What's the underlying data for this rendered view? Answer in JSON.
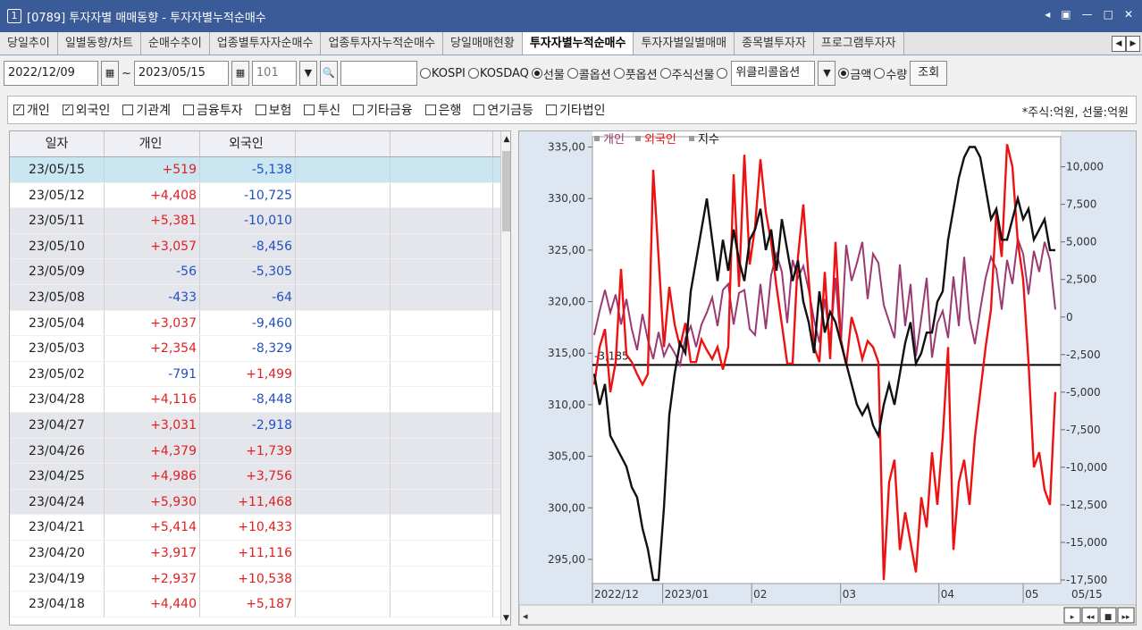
{
  "window": {
    "number": "1",
    "title": "[0789] 투자자별 매매동향 - 투자자별누적순매수",
    "controls": [
      "◂",
      "▣",
      "—",
      "□",
      "✕"
    ]
  },
  "tabs": [
    "당일추이",
    "일별동향/차트",
    "순매수추이",
    "업종별투자자순매수",
    "업종투자자누적순매수",
    "당일매매현황",
    "투자자별누적순매수",
    "투자자별일별매매",
    "종목별투자자",
    "프로그램투자자"
  ],
  "active_tab": 6,
  "toolbar": {
    "start_date": "2022/12/09",
    "tilde": "~",
    "end_date": "2023/05/15",
    "code": "101",
    "code_input": "",
    "market_radios": [
      {
        "label": "KOSPI",
        "checked": false
      },
      {
        "label": "KOSDAQ",
        "checked": false
      },
      {
        "label": "선물",
        "checked": true
      },
      {
        "label": "콜옵션",
        "checked": false
      },
      {
        "label": "풋옵션",
        "checked": false
      },
      {
        "label": "주식선물",
        "checked": false
      },
      {
        "label": "",
        "checked": false
      }
    ],
    "weekly_select": "위클리콜옵션",
    "unit_radios": [
      {
        "label": "금액",
        "checked": true
      },
      {
        "label": "수량",
        "checked": false
      }
    ],
    "search_button": "조회"
  },
  "investor_checks": [
    {
      "label": "개인",
      "checked": true
    },
    {
      "label": "외국인",
      "checked": true
    },
    {
      "label": "기관계",
      "checked": false
    },
    {
      "label": "금융투자",
      "checked": false
    },
    {
      "label": "보험",
      "checked": false
    },
    {
      "label": "투신",
      "checked": false
    },
    {
      "label": "기타금융",
      "checked": false
    },
    {
      "label": "은행",
      "checked": false
    },
    {
      "label": "연기금등",
      "checked": false
    },
    {
      "label": "기타법인",
      "checked": false
    }
  ],
  "unit_note": "*주식:억원, 선물:억원",
  "table": {
    "headers": [
      "일자",
      "개인",
      "외국인",
      "",
      ""
    ],
    "rows": [
      [
        "23/05/15",
        "+519",
        "-5,138"
      ],
      [
        "23/05/12",
        "+4,408",
        "-10,725"
      ],
      [
        "23/05/11",
        "+5,381",
        "-10,010"
      ],
      [
        "23/05/10",
        "+3,057",
        "-8,456"
      ],
      [
        "23/05/09",
        "-56",
        "-5,305"
      ],
      [
        "23/05/08",
        "-433",
        "-64"
      ],
      [
        "23/05/04",
        "+3,037",
        "-9,460"
      ],
      [
        "23/05/03",
        "+2,354",
        "-8,329"
      ],
      [
        "23/05/02",
        "-791",
        "+1,499"
      ],
      [
        "23/04/28",
        "+4,116",
        "-8,448"
      ],
      [
        "23/04/27",
        "+3,031",
        "-2,918"
      ],
      [
        "23/04/26",
        "+4,379",
        "+1,739"
      ],
      [
        "23/04/25",
        "+4,986",
        "+3,756"
      ],
      [
        "23/04/24",
        "+5,930",
        "+11,468"
      ],
      [
        "23/04/21",
        "+5,414",
        "+10,433"
      ],
      [
        "23/04/20",
        "+3,917",
        "+11,116"
      ],
      [
        "23/04/19",
        "+2,937",
        "+10,538"
      ],
      [
        "23/04/18",
        "+4,440",
        "+5,187"
      ]
    ]
  },
  "chart_data": {
    "type": "line",
    "legend": [
      "개인",
      "외국인",
      "지수"
    ],
    "legend_placement": "top-left",
    "left_axis": {
      "ticks": [
        "335,00",
        "330,00",
        "325,00",
        "320,00",
        "315,00",
        "310,00",
        "305,00",
        "300,00",
        "295,00"
      ],
      "ylim": [
        293,
        336
      ]
    },
    "right_axis": {
      "ticks": [
        "10,000",
        "7,500",
        "5,000",
        "2,500",
        "0",
        "-2,500",
        "-5,000",
        "-7,500",
        "-10,000",
        "-12,500",
        "-15,000",
        "-17,500"
      ],
      "ylim": [
        -17500,
        12000
      ]
    },
    "x_labels": [
      "2022/12",
      "2023/01",
      "02",
      "03",
      "04",
      "05",
      "05/15"
    ],
    "reference_label": "-3,185",
    "reference_value": -3185,
    "series": [
      {
        "name": "개인",
        "color": "#9b3a72",
        "axis": "right",
        "values": [
          -1200,
          400,
          1800,
          300,
          1500,
          -500,
          1200,
          -800,
          -2200,
          200,
          -1500,
          -2800,
          -1000,
          -2600,
          -1800,
          -2400,
          -3200,
          -1400,
          -600,
          -2000,
          -500,
          300,
          1300,
          -600,
          1800,
          2200,
          -500,
          1600,
          1800,
          -800,
          -1200,
          2200,
          -800,
          2800,
          4200,
          3000,
          -400,
          3800,
          2600,
          3400,
          1800,
          -200,
          -1700,
          1200,
          -1600,
          2600,
          -1800,
          4800,
          2400,
          3600,
          5000,
          1200,
          4200,
          3600,
          800,
          -300,
          -1400,
          3500,
          -600,
          2200,
          -2600,
          -100,
          2600,
          -2700,
          -400,
          400,
          -1400,
          2700,
          -600,
          4000,
          -100,
          -1800,
          500,
          2600,
          4000,
          3200,
          500,
          3800,
          2200,
          5200,
          4200,
          1500,
          4400,
          3000,
          5000,
          3800,
          500
        ]
      },
      {
        "name": "외국인",
        "color": "#ee1111",
        "axis": "right",
        "values": [
          -4500,
          -2000,
          -800,
          -5000,
          -3000,
          3200,
          -2500,
          -3000,
          -3800,
          -4500,
          -3800,
          9800,
          4000,
          -2000,
          2000,
          -500,
          -2000,
          -400,
          -3000,
          -3000,
          -1500,
          -2200,
          -2800,
          -2000,
          -3500,
          -2000,
          9500,
          2000,
          10800,
          3500,
          6000,
          10500,
          7000,
          5000,
          2000,
          -500,
          -3100,
          -3100,
          4000,
          7500,
          2500,
          -2000,
          -3000,
          3000,
          -2800,
          5000,
          -1500,
          -3200,
          0,
          -1200,
          -2800,
          -1600,
          -2000,
          -3000,
          -17500,
          -11000,
          -9500,
          -15500,
          -13000,
          -15000,
          -17000,
          -12000,
          -14000,
          -9000,
          -12500,
          -8000,
          -2000,
          -15500,
          -11000,
          -9500,
          -12500,
          -8000,
          -5000,
          -2000,
          500,
          7000,
          4000,
          11500,
          10000,
          5000,
          2500,
          -3000,
          -10000,
          -9000,
          -11500,
          -12500,
          -5000
        ]
      },
      {
        "name": "지수",
        "color": "#111111",
        "axis": "left",
        "values": [
          313,
          310,
          312,
          307,
          306,
          305,
          304,
          302,
          301,
          298,
          296,
          293,
          293,
          300,
          309,
          313,
          316,
          315,
          321,
          324,
          327,
          330,
          326,
          322,
          326,
          323,
          327,
          324,
          322,
          326,
          327,
          329,
          325,
          327,
          323,
          328,
          325,
          322,
          324,
          320,
          318,
          315,
          321,
          317,
          319,
          318,
          316,
          314,
          312,
          310,
          309,
          310,
          308,
          307,
          310,
          312,
          310,
          313,
          316,
          318,
          314,
          315,
          317,
          317,
          320,
          321,
          326,
          329,
          332,
          334,
          335,
          335,
          334,
          331,
          328,
          329,
          326,
          326,
          328,
          330,
          328,
          329,
          326,
          327,
          328,
          325,
          325
        ]
      }
    ]
  },
  "hscroll_buttons": [
    "▸",
    "◂◂",
    "■",
    "▸▸"
  ]
}
